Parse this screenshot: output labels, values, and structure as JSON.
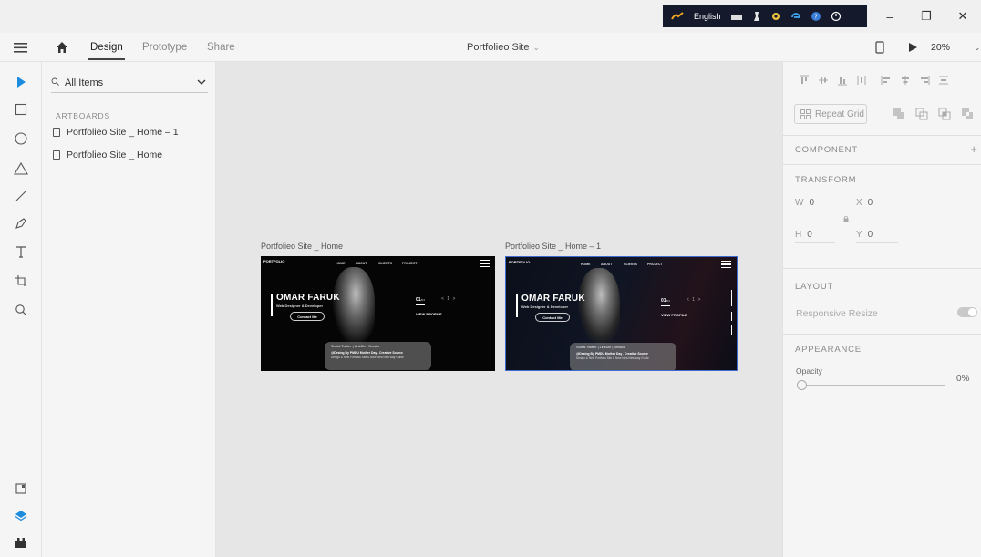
{
  "ime_bar": {
    "language": "English"
  },
  "window_controls": {
    "minimize": "–",
    "restore": "❐",
    "close": "✕"
  },
  "toolbar": {
    "tabs": [
      {
        "label": "Design",
        "active": true
      },
      {
        "label": "Prototype",
        "active": false
      },
      {
        "label": "Share",
        "active": false
      }
    ],
    "document_title": "Portfolieo Site",
    "zoom": "20%"
  },
  "tools": [
    "select-icon",
    "rectangle-icon",
    "ellipse-icon",
    "triangle-icon",
    "line-icon",
    "pen-icon",
    "text-icon",
    "artboard-icon",
    "zoom-icon"
  ],
  "bottom_rail": [
    "assets-icon",
    "layers-icon",
    "plugins-icon"
  ],
  "layers_panel": {
    "search_filter": "All Items",
    "section_title": "ARTBOARDS",
    "items": [
      "Portfolieo Site _ Home – 1",
      "Portfolieo Site _ Home"
    ]
  },
  "canvas": {
    "artboards": [
      {
        "label": "Portfolieo Site _ Home",
        "logo": "PORTFOLIO",
        "nav": [
          "HOME",
          "ABOUT",
          "CLIENTS",
          "PROJECT"
        ],
        "name": "OMAR FARUK",
        "role": "Web Designer & Developer",
        "contact": "Contact Me",
        "slide": "01",
        "slide_total": "/04",
        "slide_arrows": "< 1 >",
        "view_profile": "VIEW PROFILE",
        "footer_social": "Social   Twitter | LinkDin | Brosko",
        "footer_credit": "@Desing By PMDU Mother Day  .  Creative Source",
        "footer_desc": "Design & New Portfolio Site & New Idea  New way Guide"
      },
      {
        "label": "Portfolieo Site _ Home – 1",
        "logo": "PORTFOLIO",
        "nav": [
          "HOME",
          "ABOUT",
          "CLIENTS",
          "PROJECT"
        ],
        "name": "OMAR FARUK",
        "role": "Web Designer & Developer",
        "contact": "Contact Me",
        "slide": "01",
        "slide_total": "/04",
        "slide_arrows": "< 1 >",
        "view_profile": "VIEW PROFILE",
        "footer_social": "Social   Twitter | LinkDin | Brosko",
        "footer_credit": "@Desing By PMDU Mother Day  .  Creative Source",
        "footer_desc": "Design & New Portfolio Site & New Idea  New way Guide"
      }
    ]
  },
  "properties": {
    "repeat_grid": "Repeat Grid",
    "component_title": "COMPONENT",
    "component_add": "+",
    "transform_title": "TRANSFORM",
    "w_label": "W",
    "w_value": "0",
    "x_label": "X",
    "x_value": "0",
    "h_label": "H",
    "h_value": "0",
    "y_label": "Y",
    "y_value": "0",
    "layout_title": "LAYOUT",
    "responsive_resize": "Responsive Resize",
    "responsive_resize_on": false,
    "appearance_title": "APPEARANCE",
    "opacity_label": "Opacity",
    "opacity_value": "0%",
    "opacity_fraction": 0
  },
  "colors": {
    "selection_blue": "#3f6bd0",
    "panel_bg": "#f5f5f5",
    "canvas_bg": "#e6e6e6",
    "tool_accent": "#1d8bde"
  }
}
